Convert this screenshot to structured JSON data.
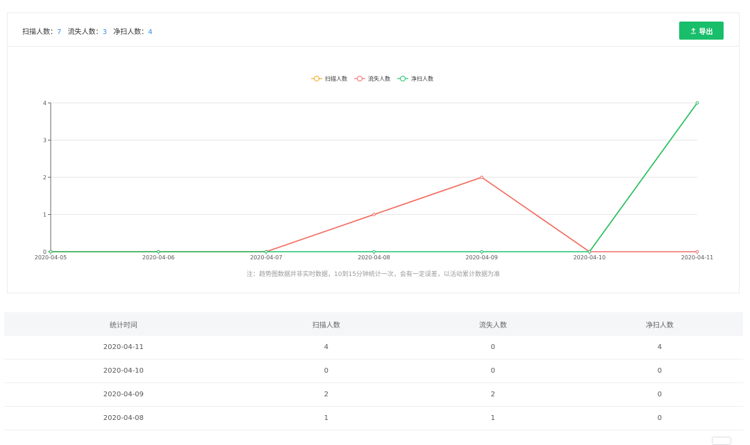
{
  "header": {
    "stats": [
      {
        "label": "扫描人数：",
        "value": "7"
      },
      {
        "label": "流失人数：",
        "value": "3"
      },
      {
        "label": "净扫人数：",
        "value": "4"
      }
    ],
    "export_label": "导出"
  },
  "colors": {
    "scan": "#f5a623",
    "lost": "#f26c6c",
    "net": "#1ec36b",
    "export_button": "#19be6b",
    "stat_number": "#3a8ee6"
  },
  "chart_data": {
    "type": "line",
    "x": [
      "2020-04-05",
      "2020-04-06",
      "2020-04-07",
      "2020-04-08",
      "2020-04-09",
      "2020-04-10",
      "2020-04-11"
    ],
    "series": [
      {
        "name": "扫描人数",
        "values": [
          0,
          0,
          0,
          1,
          2,
          0,
          4
        ]
      },
      {
        "name": "流失人数",
        "values": [
          0,
          0,
          0,
          1,
          2,
          0,
          0
        ]
      },
      {
        "name": "净扫人数",
        "values": [
          0,
          0,
          0,
          0,
          0,
          0,
          4
        ]
      }
    ],
    "ylim": [
      0,
      4
    ],
    "yticks": [
      "0",
      "1",
      "2",
      "3",
      "4"
    ],
    "grid": true,
    "legend": "top-center"
  },
  "note": "注：趋势图数据并非实时数据，10到15分钟统计一次，会有一定误差，以活动累计数据为准",
  "table": {
    "headers": [
      "统计时间",
      "扫描人数",
      "流失人数",
      "净扫人数"
    ],
    "rows": [
      [
        "2020-04-11",
        "4",
        "0",
        "4"
      ],
      [
        "2020-04-10",
        "0",
        "0",
        "0"
      ],
      [
        "2020-04-09",
        "2",
        "2",
        "0"
      ],
      [
        "2020-04-08",
        "1",
        "1",
        "0"
      ]
    ]
  }
}
